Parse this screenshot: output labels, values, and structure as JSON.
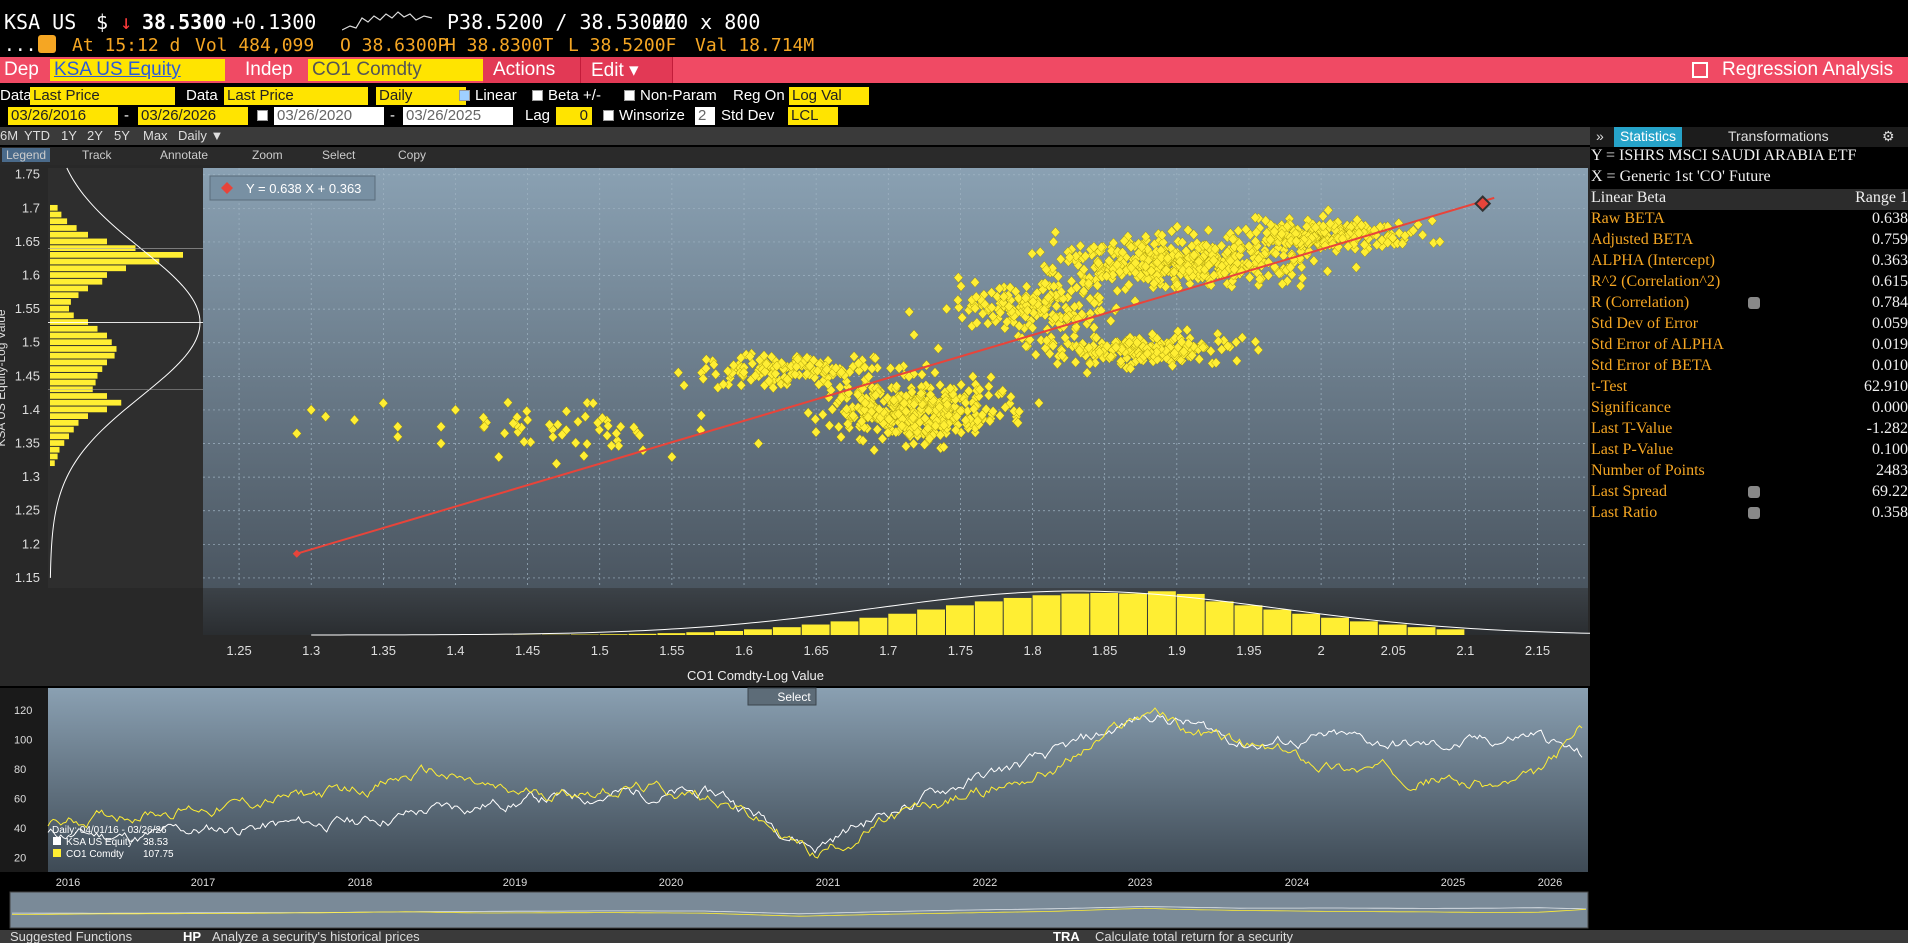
{
  "quote": {
    "ticker": "KSA US",
    "currency_symbol": "$",
    "arrow": "↓",
    "price": "38.5300",
    "change": "+0.1300",
    "bid_ask": "P38.5200 / 38.5300Z",
    "size": "200 x 800"
  },
  "quote2": {
    "dots": ".....",
    "at": "At  15:12 d",
    "vol": "Vol  484,099",
    "open": "O 38.6300P",
    "high": "H 38.8300T",
    "low": "L 38.5200F",
    "val": "Val  18.714M"
  },
  "toolbar": {
    "dep_label": "Dep",
    "dep_value": "KSA US Equity",
    "indep_label": "Indep",
    "indep_value": "CO1 Comdty",
    "actions": "Actions ▾",
    "edit": "Edit ▾",
    "title": "Regression Analysis"
  },
  "params1": {
    "data1_label": "Data",
    "data1_value": "Last Price",
    "data2_label": "Data",
    "data2_value": "Last Price",
    "freq": "Daily",
    "linear": "Linear",
    "beta": "Beta +/-",
    "nonparam": "Non-Param",
    "regon": "Reg On",
    "regon_value": "Log Val"
  },
  "params2": {
    "d1": "03/26/2016",
    "d2": "03/26/2026",
    "d3": "03/26/2020",
    "d4": "03/26/2025",
    "lag_label": "Lag",
    "lag_value": "0",
    "winsorize": "Winsorize",
    "std_value": "2",
    "std_label": "Std Dev",
    "lcl": "LCL"
  },
  "periods": [
    "6M",
    "YTD",
    "1Y",
    "2Y",
    "5Y",
    "Max",
    "Daily ▼"
  ],
  "chart_tools": [
    "Legend",
    "Track",
    "Annotate",
    "Zoom",
    "Select",
    "Copy"
  ],
  "right_tabs": {
    "statistics": "Statistics",
    "transformations": "Transformations"
  },
  "stats": {
    "y_label": "Y = ISHRS MSCI SAUDI ARABIA ETF",
    "x_label": "X = Generic 1st 'CO' Future",
    "header_left": "Linear Beta",
    "header_right": "Range 1",
    "rows": [
      {
        "k": "Raw BETA",
        "v": "0.638"
      },
      {
        "k": "Adjusted BETA",
        "v": "0.759"
      },
      {
        "k": "ALPHA (Intercept)",
        "v": "0.363"
      },
      {
        "k": "R^2 (Correlation^2)",
        "v": "0.615"
      },
      {
        "k": "R (Correlation)",
        "v": "0.784"
      },
      {
        "k": "Std Dev of Error",
        "v": "0.059"
      },
      {
        "k": "Std Error of ALPHA",
        "v": "0.019"
      },
      {
        "k": "Std Error of BETA",
        "v": "0.010"
      },
      {
        "k": "t-Test",
        "v": "62.910"
      },
      {
        "k": "Significance",
        "v": "0.000"
      },
      {
        "k": "Last T-Value",
        "v": "-1.282"
      },
      {
        "k": "Last P-Value",
        "v": "0.100"
      },
      {
        "k": "Number of Points",
        "v": "2483"
      },
      {
        "k": "Last Spread",
        "v": "69.22"
      },
      {
        "k": "Last Ratio",
        "v": "0.358"
      }
    ]
  },
  "scatter": {
    "equation": "Y = 0.638 X + 0.363",
    "y_axis_title": "KSA US Equity-Log Value",
    "x_axis_title": "CO1 Comdty-Log Value",
    "y_ticks": [
      "1.75",
      "1.7",
      "1.65",
      "1.6",
      "1.55",
      "1.5",
      "1.45",
      "1.4",
      "1.35",
      "1.3",
      "1.25",
      "1.2",
      "1.15"
    ],
    "x_ticks": [
      "1.25",
      "1.3",
      "1.35",
      "1.4",
      "1.45",
      "1.5",
      "1.55",
      "1.6",
      "1.65",
      "1.7",
      "1.75",
      "1.8",
      "1.85",
      "1.9",
      "1.95",
      "2",
      "2.05",
      "2.1",
      "2.15"
    ],
    "colors": {
      "points": "#ffee33",
      "line": "#e8443a",
      "bg_top": "#8aa1b3",
      "bg_bottom": "#4a5560"
    }
  },
  "timeseries": {
    "select_label": "Select",
    "y_ticks": [
      "120",
      "100",
      "80",
      "60",
      "40",
      "20"
    ],
    "years": [
      "2016",
      "2017",
      "2018",
      "2019",
      "2020",
      "2021",
      "2022",
      "2023",
      "2024",
      "2025",
      "2026"
    ],
    "legend_title": "Daily: 04/01/16 - 03/26/26",
    "legend": [
      {
        "name": "KSA US Equity",
        "value": "38.53",
        "color": "#ffffff"
      },
      {
        "name": "CO1 Comdty",
        "value": "107.75",
        "color": "#ffee33"
      }
    ]
  },
  "footer": {
    "left": "Suggested Functions",
    "mid_code": "HP",
    "mid_text": "Analyze a security's historical prices",
    "right_code": "TRA",
    "right_text": "Calculate total return for a security"
  }
}
